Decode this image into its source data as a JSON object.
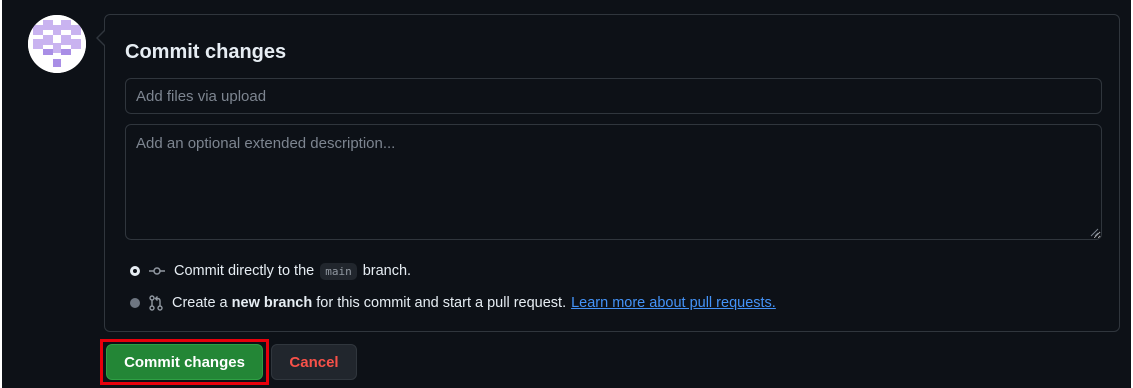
{
  "commit_form": {
    "title": "Commit changes",
    "summary": {
      "placeholder": "Add files via upload",
      "value": ""
    },
    "description": {
      "placeholder": "Add an optional extended description...",
      "value": ""
    },
    "options": [
      {
        "selected": true,
        "icon": "git-commit-icon",
        "text_before": "Commit directly to the",
        "branch": "main",
        "text_after": "branch."
      },
      {
        "selected": false,
        "icon": "git-pull-request-icon",
        "text_before": "Create a",
        "text_bold": "new branch",
        "text_after": "for this commit and start a pull request.",
        "link": "Learn more about pull requests."
      }
    ]
  },
  "actions": {
    "commit_label": "Commit changes",
    "cancel_label": "Cancel"
  },
  "colors": {
    "background": "#0d1117",
    "border": "#30363d",
    "primary_button": "#238636",
    "danger_text": "#f85149",
    "link": "#4493f8",
    "highlight": "#e8000b"
  }
}
